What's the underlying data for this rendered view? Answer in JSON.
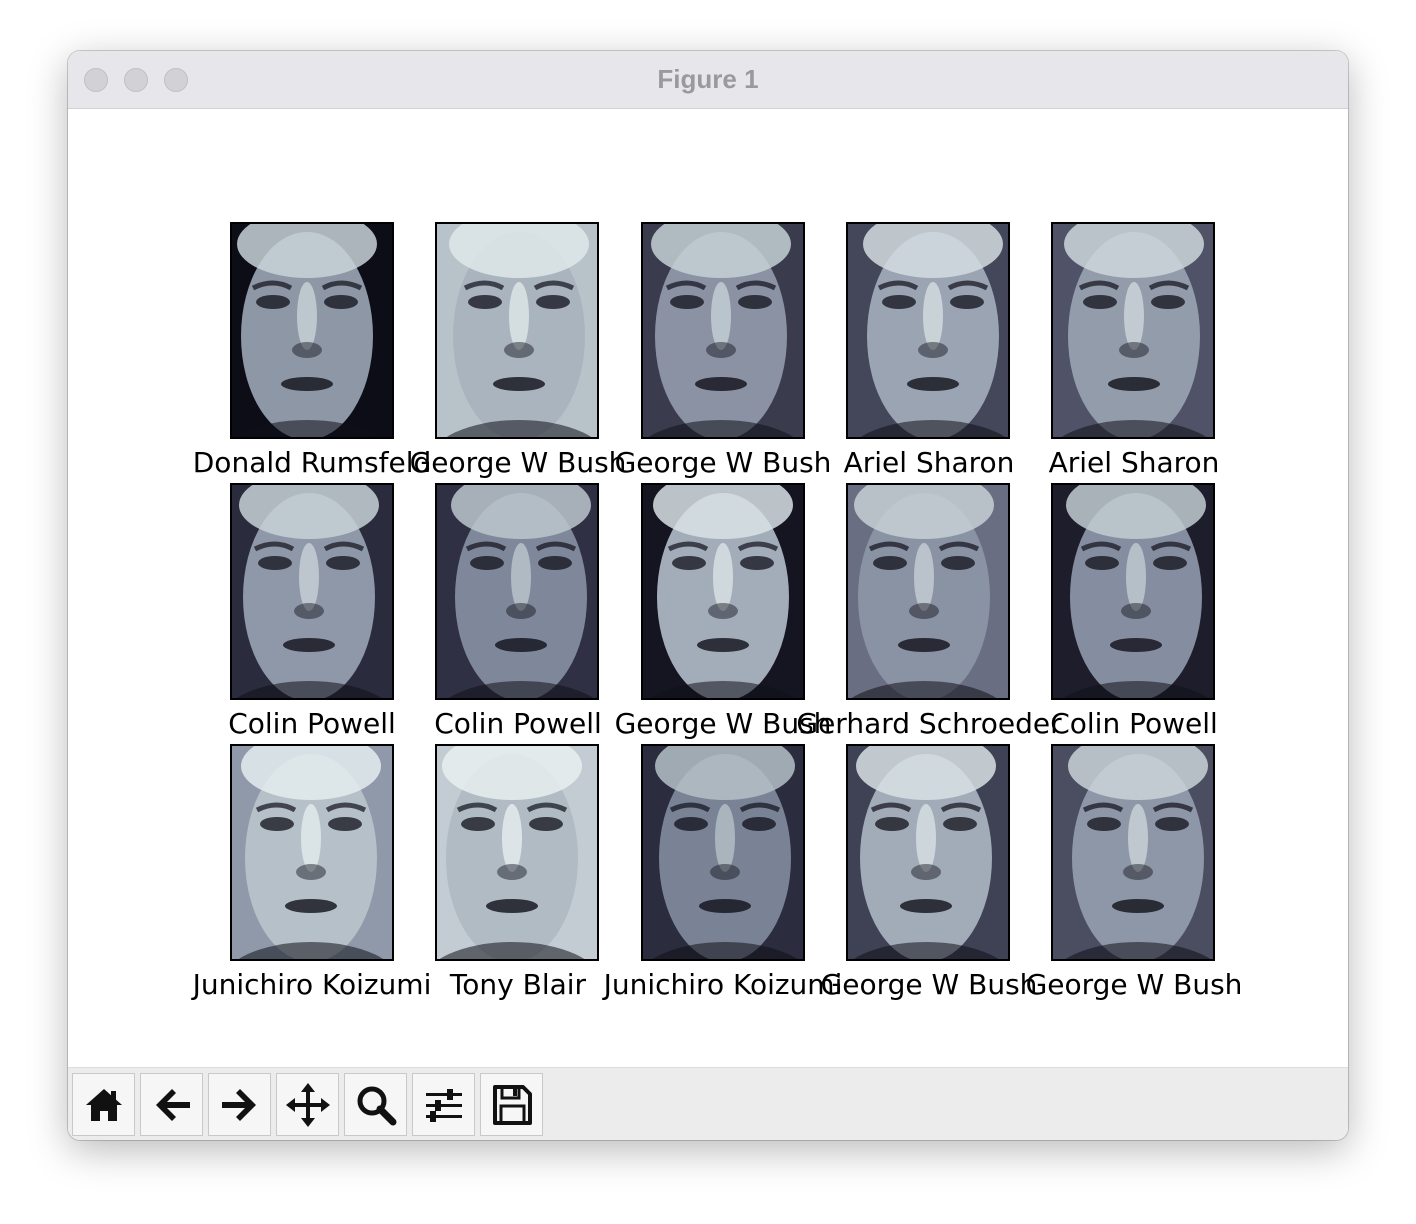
{
  "window": {
    "title": "Figure 1"
  },
  "gallery": {
    "colormap": "bone",
    "faces": [
      {
        "label": "Donald Rumsfeld"
      },
      {
        "label": "George W Bush"
      },
      {
        "label": "George W Bush"
      },
      {
        "label": "Ariel Sharon"
      },
      {
        "label": "Ariel Sharon"
      },
      {
        "label": "Colin Powell"
      },
      {
        "label": "Colin Powell"
      },
      {
        "label": "George W Bush"
      },
      {
        "label": "Gerhard Schroeder"
      },
      {
        "label": "Colin Powell"
      },
      {
        "label": "Junichiro Koizumi"
      },
      {
        "label": "Tony Blair"
      },
      {
        "label": "Junichiro Koizumi"
      },
      {
        "label": "George W Bush"
      },
      {
        "label": "George W Bush"
      }
    ]
  },
  "toolbar": {
    "buttons": [
      {
        "icon": "home-icon"
      },
      {
        "icon": "back-arrow-icon"
      },
      {
        "icon": "forward-arrow-icon"
      },
      {
        "icon": "pan-move-icon"
      },
      {
        "icon": "zoom-magnifier-icon"
      },
      {
        "icon": "configure-subplots-icon"
      },
      {
        "icon": "save-floppy-icon"
      }
    ]
  }
}
